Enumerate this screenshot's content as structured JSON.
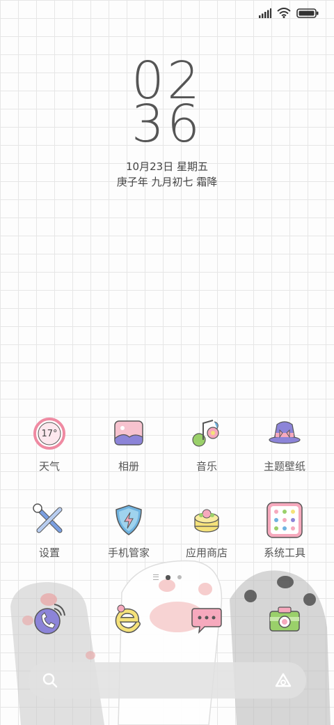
{
  "status": {
    "signal": "signal-icon",
    "wifi": "wifi-icon",
    "battery": "battery-icon"
  },
  "clock": {
    "hours": "02",
    "minutes": "36"
  },
  "date": {
    "gregorian": "10月23日  星期五",
    "lunar": "庚子年 九月初七 霜降"
  },
  "apps_row1": [
    {
      "label": "天气",
      "icon": "weather-icon",
      "temperature": "17°"
    },
    {
      "label": "相册",
      "icon": "gallery-icon"
    },
    {
      "label": "音乐",
      "icon": "music-icon"
    },
    {
      "label": "主题壁纸",
      "icon": "theme-icon"
    }
  ],
  "apps_row2": [
    {
      "label": "设置",
      "icon": "settings-icon"
    },
    {
      "label": "手机管家",
      "icon": "security-icon"
    },
    {
      "label": "应用商店",
      "icon": "app-store-icon"
    },
    {
      "label": "系统工具",
      "icon": "tools-folder-icon"
    }
  ],
  "dock": [
    {
      "icon": "phone-icon"
    },
    {
      "icon": "browser-icon"
    },
    {
      "icon": "messages-icon"
    },
    {
      "icon": "camera-icon"
    }
  ],
  "pager": {
    "pages": 2,
    "active": 1
  },
  "colors": {
    "pink": "#f4b6c2",
    "purple": "#7a6fd0",
    "green": "#9ad06a",
    "yellow": "#f5e27a",
    "blue": "#6fb3e0"
  }
}
